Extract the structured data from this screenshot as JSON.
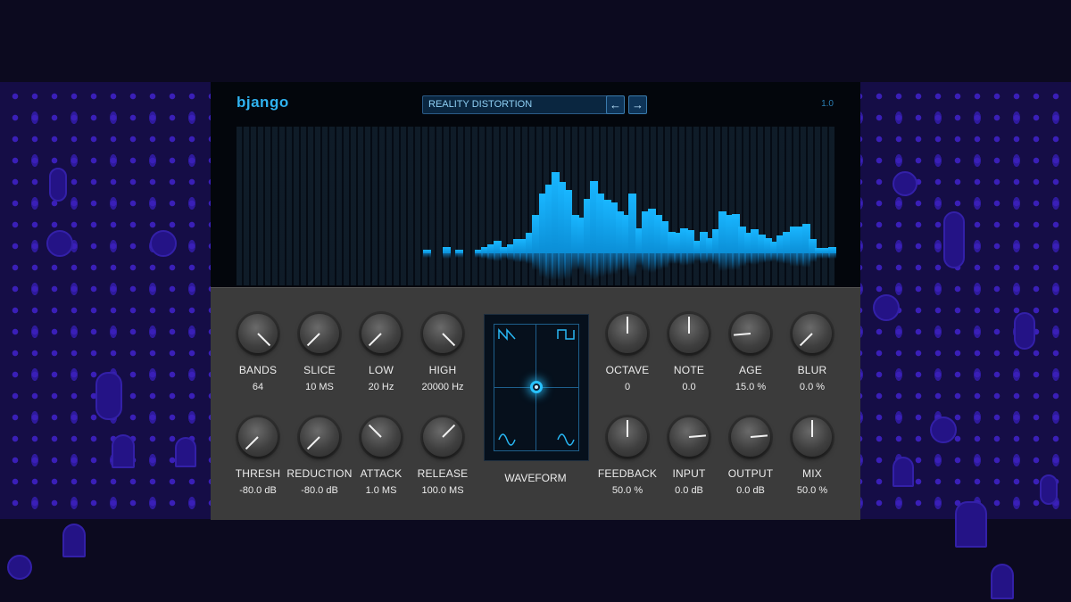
{
  "header": {
    "logo": "bjango",
    "preset_name": "REALITY DISTORTION",
    "prev_icon": "arrow-left-icon",
    "next_icon": "arrow-right-icon",
    "version": "1.0"
  },
  "colors": {
    "accent": "#19b6ff",
    "panel": "#3b3b3b",
    "background": "#150d46"
  },
  "spectrum": {
    "levels": [
      0,
      0,
      0,
      0,
      0,
      0,
      0,
      0,
      0,
      0,
      0,
      0,
      0,
      0,
      0,
      0,
      0,
      0,
      0,
      0,
      0,
      0,
      0,
      0,
      0,
      0,
      0,
      0,
      0,
      0.03,
      0,
      0,
      0.05,
      0,
      0.03,
      0,
      0,
      0.03,
      0.05,
      0.07,
      0.1,
      0.05,
      0.07,
      0.11,
      0.11,
      0.16,
      0.3,
      0.47,
      0.54,
      0.64,
      0.56,
      0.5,
      0.3,
      0.28,
      0.43,
      0.57,
      0.47,
      0.42,
      0.4,
      0.33,
      0.3,
      0.47,
      0.2,
      0.33,
      0.35,
      0.3,
      0.25,
      0.17,
      0.16,
      0.2,
      0.18,
      0.1,
      0.17,
      0.12,
      0.19,
      0.33,
      0.3,
      0.31,
      0.21,
      0.16,
      0.19,
      0.15,
      0.12,
      0.09,
      0.14,
      0.17,
      0.21,
      0.21,
      0.23,
      0.11,
      0.04,
      0.04,
      0.05
    ]
  },
  "knobs": {
    "bands": {
      "label": "BANDS",
      "value": "64"
    },
    "slice": {
      "label": "SLICE",
      "value": "10 MS"
    },
    "low": {
      "label": "LOW",
      "value": "20 Hz"
    },
    "high": {
      "label": "HIGH",
      "value": "20000 Hz"
    },
    "thresh": {
      "label": "THRESH",
      "value": "-80.0 dB"
    },
    "reduction": {
      "label": "REDUCTION",
      "value": "-80.0 dB"
    },
    "attack": {
      "label": "ATTACK",
      "value": "1.0 MS"
    },
    "release": {
      "label": "RELEASE",
      "value": "100.0 MS"
    },
    "octave": {
      "label": "OCTAVE",
      "value": "0"
    },
    "note": {
      "label": "NOTE",
      "value": "0.0"
    },
    "age": {
      "label": "AGE",
      "value": "15.0 %"
    },
    "blur": {
      "label": "BLUR",
      "value": "0.0 %"
    },
    "feedback": {
      "label": "FEEDBACK",
      "value": "50.0 %"
    },
    "input": {
      "label": "INPUT",
      "value": "0.0 dB"
    },
    "output": {
      "label": "OUTPUT",
      "value": "0.0 dB"
    },
    "mix": {
      "label": "MIX",
      "value": "50.0 %"
    }
  },
  "waveform": {
    "label": "WAVEFORM",
    "corner_icons": [
      "sawtooth-wave-icon",
      "square-wave-icon",
      "sine-wave-icon",
      "sine-wave-icon"
    ]
  }
}
